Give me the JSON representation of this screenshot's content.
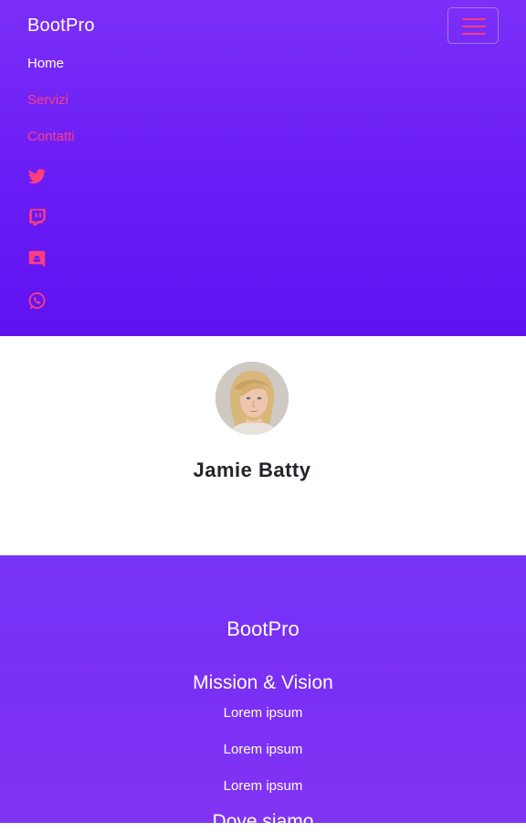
{
  "navbar": {
    "brand": "BootPro",
    "toggler_icon": "hamburger-icon",
    "links": [
      {
        "label": "Home",
        "active": true
      },
      {
        "label": "Servizi",
        "active": false
      },
      {
        "label": "Contatti",
        "active": false
      }
    ],
    "social_icons": [
      "twitter-icon",
      "twitch-icon",
      "discord-icon",
      "whatsapp-icon"
    ]
  },
  "profile": {
    "name": "Jamie Batty"
  },
  "footer": {
    "brand": "BootPro",
    "section_title": "Mission & Vision",
    "links": [
      "Lorem ipsum",
      "Lorem ipsum",
      "Lorem ipsum"
    ],
    "next_section_title": "Dove siamo"
  },
  "colors": {
    "accent": "#ff3d7f",
    "header_gradient_top": "#7b2ff7",
    "header_gradient_bottom": "#5f12f0",
    "footer_bg": "#7a2ff5"
  }
}
